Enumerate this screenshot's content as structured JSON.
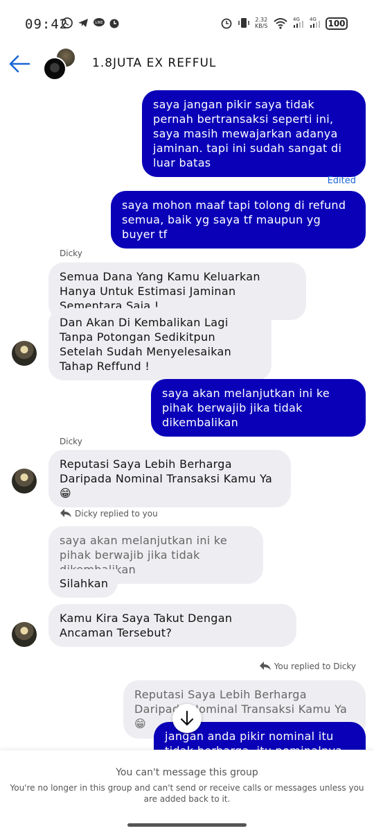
{
  "status_bar": {
    "time": "09:42",
    "net_speed": "2.32\nKB/S",
    "net_type_1": "4G",
    "net_type_2": "4G",
    "battery": "100",
    "icons": [
      "whatsapp-icon",
      "telegram-icon",
      "line-icon",
      "alarm-icon",
      "alarm-icon",
      "vibrate-icon",
      "wifi-icon",
      "signal-icon",
      "signal-icon"
    ]
  },
  "header": {
    "title": "1.8JUTA EX REFFUL",
    "back_icon": "back-arrow-icon"
  },
  "messages": {
    "m1": "saya jangan pikir saya tidak pernah bertransaksi seperti ini, saya masih mewajarkan adanya jaminan. tapi ini sudah sangat di luar batas",
    "edited": "Edited",
    "m2": "saya mohon maaf tapi tolong di refund semua, baik yg saya tf maupun yg buyer tf",
    "sender1": "Dicky",
    "m3": "Semua Dana Yang Kamu Keluarkan Hanya Untuk Estimasi Jaminan Sementara Saja !",
    "m4": "Dan Akan Di Kembalikan Lagi Tanpa Potongan Sedikitpun Setelah Sudah Menyelesaikan Tahap Reffund !",
    "m5": "saya akan melanjutkan ini ke pihak berwajib jika tidak dikembalikan",
    "sender2": "Dicky",
    "m6": "Reputasi Saya Lebih Berharga Daripada Nominal Transaksi Kamu Ya 😁",
    "reply1_label": "Dicky replied to you",
    "reply1_quote": "saya akan melanjutkan ini ke pihak berwajib jika tidak dikembalikan",
    "m7": "Silahkan",
    "m8": "Kamu Kira Saya Takut Dengan Ancaman Tersebut?",
    "reply2_label": "You replied to Dicky",
    "reply2_quote": "Reputasi Saya Lebih Berharga Daripada Nominal Transaksi Kamu Ya 😁",
    "m9": "jangan anda pikir nominal itu tidak berharga, itu nominalnya besar"
  },
  "footer": {
    "title": "You can't message this group",
    "subtitle": "You're no longer in this group and can't send or receive calls or messages unless you are added back to it."
  },
  "colors": {
    "outgoing_bubble": "#0a00b8",
    "incoming_bubble": "#eeeef2",
    "accent": "#1a66d6"
  }
}
